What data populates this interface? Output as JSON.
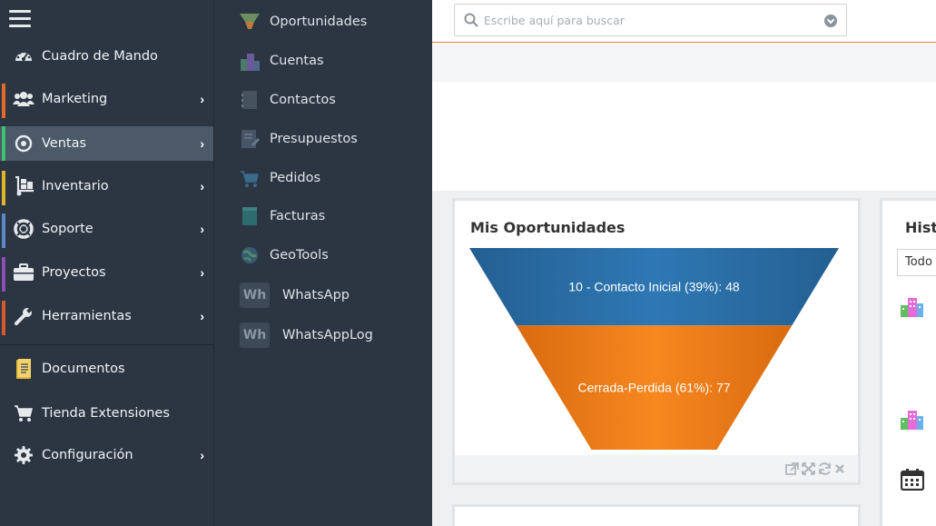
{
  "sidebar": {
    "items": [
      {
        "label": "Cuadro de Mando",
        "icon": "dashboard-icon",
        "color": "",
        "has_arrow": false
      },
      {
        "label": "Marketing",
        "icon": "users-icon",
        "color": "#e26a2c",
        "has_arrow": true
      },
      {
        "label": "Ventas",
        "icon": "target-icon",
        "color": "#3fbf74",
        "has_arrow": true,
        "active": true
      },
      {
        "label": "Inventario",
        "icon": "dolly-icon",
        "color": "#e0b52a",
        "has_arrow": true
      },
      {
        "label": "Soporte",
        "icon": "lifebuoy-icon",
        "color": "#5d88c8",
        "has_arrow": true
      },
      {
        "label": "Proyectos",
        "icon": "briefcase-icon",
        "color": "#8a4fb5",
        "has_arrow": true
      },
      {
        "label": "Herramientas",
        "icon": "wrench-icon",
        "color": "#d9592f",
        "has_arrow": true
      },
      {
        "label": "Documentos",
        "icon": "document-icon",
        "color": "",
        "has_arrow": false
      },
      {
        "label": "Tienda Extensiones",
        "icon": "cart-icon",
        "color": "",
        "has_arrow": false
      },
      {
        "label": "Configuración",
        "icon": "gear-icon",
        "color": "",
        "has_arrow": true
      }
    ]
  },
  "submenu": {
    "items": [
      {
        "label": "Oportunidades",
        "icon": "funnel-icon"
      },
      {
        "label": "Cuentas",
        "icon": "buildings-icon"
      },
      {
        "label": "Contactos",
        "icon": "contact-book-icon"
      },
      {
        "label": "Presupuestos",
        "icon": "quote-icon"
      },
      {
        "label": "Pedidos",
        "icon": "order-cart-icon"
      },
      {
        "label": "Facturas",
        "icon": "invoice-icon"
      },
      {
        "label": "GeoTools",
        "icon": "globe-icon"
      },
      {
        "label": "WhatsApp",
        "icon": "wh-badge",
        "badge": "Wh"
      },
      {
        "label": "WhatsAppLog",
        "icon": "wh-badge",
        "badge": "Wh"
      }
    ]
  },
  "search": {
    "placeholder": "Escribe aquí para buscar"
  },
  "widget": {
    "title": "Mis Oportunidades"
  },
  "chart_data": {
    "type": "funnel",
    "title": "Mis Oportunidades",
    "categories": [
      "10 - Contacto Inicial",
      "Cerrada-Perdida"
    ],
    "values": [
      48,
      77
    ],
    "percentages": [
      39,
      61
    ],
    "labels": [
      "10 - Contacto Inicial (39%): 48",
      "Cerrada-Perdida (61%): 77"
    ],
    "colors": [
      "#2e76b2",
      "#f38420"
    ]
  },
  "history": {
    "title": "Historial",
    "filter": "Todo"
  }
}
